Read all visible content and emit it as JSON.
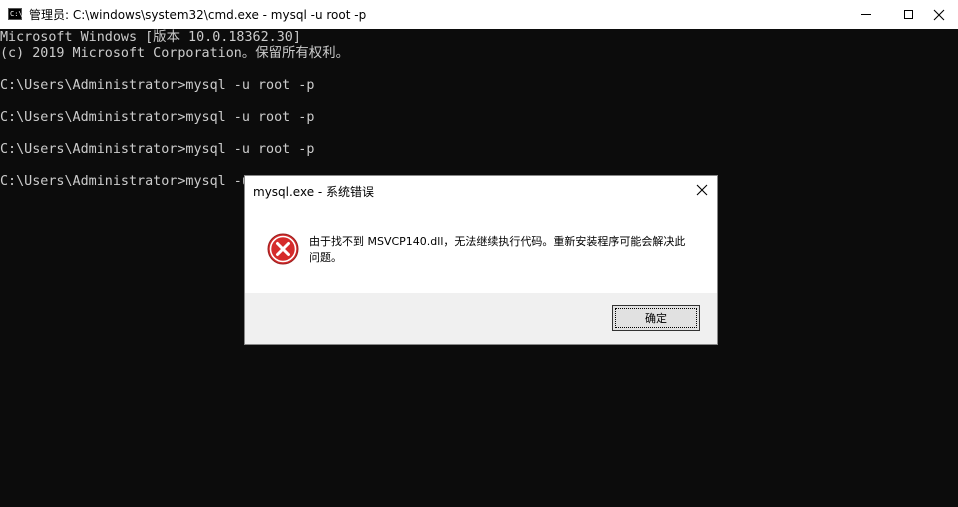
{
  "window": {
    "title": "管理员: C:\\windows\\system32\\cmd.exe - mysql  -u root -p",
    "icon": "console-app-icon",
    "icon_text": "C:\\",
    "controls": [
      "minimize",
      "maximize",
      "close"
    ]
  },
  "console": {
    "lines": [
      "Microsoft Windows [版本 10.0.18362.30]",
      "(c) 2019 Microsoft Corporation。保留所有权利。",
      "",
      "C:\\Users\\Administrator>mysql -u root -p",
      "",
      "C:\\Users\\Administrator>mysql -u root -p",
      "",
      "C:\\Users\\Administrator>mysql -u root -p",
      "",
      "C:\\Users\\Administrator>mysql -u root -p"
    ],
    "text_color": "#cccccc",
    "background": "#0c0c0c"
  },
  "dialog": {
    "title": "mysql.exe - 系统错误",
    "message": "由于找不到 MSVCP140.dll，无法继续执行代码。重新安装程序可能会解决此问题。",
    "icon": "error-icon",
    "ok_label": "确定",
    "error_color": "#d52b2b"
  }
}
